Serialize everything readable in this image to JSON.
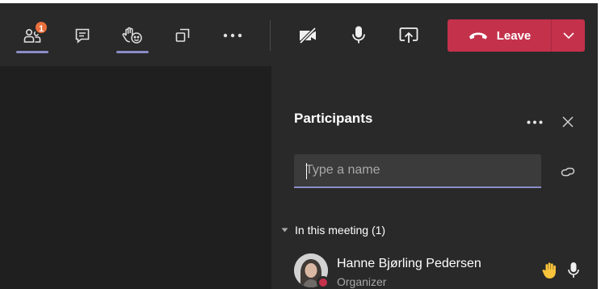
{
  "toolbar": {
    "buttons": [
      {
        "id": "participants",
        "icon": "people-icon",
        "badge": "1",
        "active": true
      },
      {
        "id": "chat",
        "icon": "chat-icon",
        "active": false
      },
      {
        "id": "reactions",
        "icon": "raise-hand-icon",
        "active": true
      },
      {
        "id": "rooms",
        "icon": "rooms-icon",
        "active": false
      },
      {
        "id": "more",
        "icon": "more-icon",
        "active": false
      },
      {
        "id": "camera",
        "icon": "camera-off-icon",
        "active": false
      },
      {
        "id": "mic",
        "icon": "microphone-icon",
        "active": false
      },
      {
        "id": "share",
        "icon": "share-screen-icon",
        "active": false
      }
    ],
    "participants_badge": "1",
    "leave_label": "Leave",
    "leave_color": "#c4314b",
    "accent_color": "#8b8cc7"
  },
  "panel": {
    "title": "Participants",
    "search_placeholder": "Type a name",
    "section_label": "In this meeting (1)",
    "participants": [
      {
        "name": "Hanne Bjørling Pedersen",
        "role": "Organizer",
        "hand_raised": true,
        "mic_on": true,
        "presence_color": "#c4314b"
      }
    ]
  }
}
